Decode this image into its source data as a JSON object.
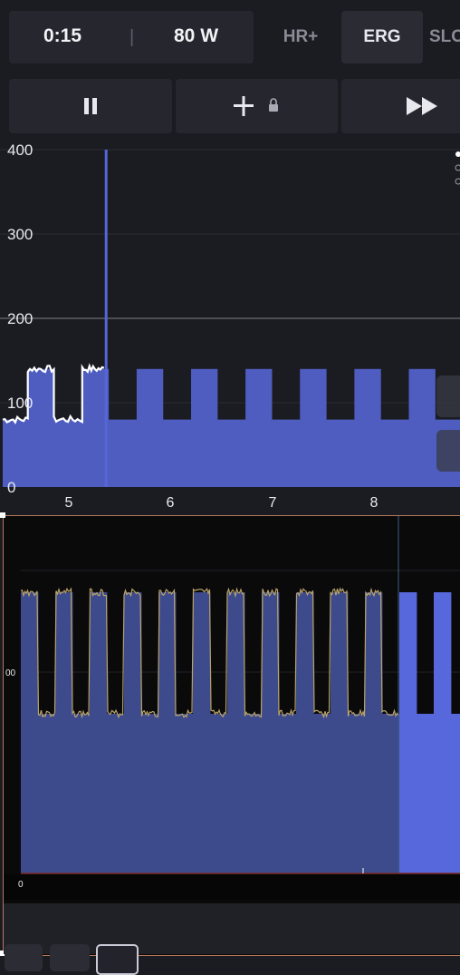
{
  "status": {
    "elapsed_time": "0:15",
    "power": "80 W"
  },
  "modes": [
    {
      "label": "HR+",
      "active": false
    },
    {
      "label": "ERG",
      "active": true
    },
    {
      "label": "SLO",
      "active": false
    }
  ],
  "controls": {
    "pause_icon": "pause-icon",
    "add_icon": "plus-icon",
    "lock_icon": "lock-icon",
    "skip_icon": "fast-forward-icon"
  },
  "colors": {
    "background": "#1b1c22",
    "plan_fill": "#4e5dbf",
    "power_line": "#ffffff",
    "cursor": "#5566d8",
    "overview_fill": "#3d4a8c",
    "overview_future": "#5767dc",
    "overview_line": "#b8a36a"
  },
  "chart_data": [
    {
      "type": "area",
      "x_tick_labels": [
        "5",
        "6",
        "7",
        "8"
      ],
      "y_tick_labels": [
        "0",
        "100",
        "200",
        "300",
        "400"
      ],
      "ylim": [
        0,
        400
      ],
      "xlim": [
        4.65,
        8.85
      ],
      "cursor_x": 5.6,
      "target_line_y": 200,
      "grid": true,
      "plan_intervals": [
        {
          "start": 4.65,
          "end": 4.88,
          "watts": 80
        },
        {
          "start": 4.88,
          "end": 5.12,
          "watts": 140
        },
        {
          "start": 5.12,
          "end": 5.38,
          "watts": 80
        },
        {
          "start": 5.38,
          "end": 5.62,
          "watts": 140
        },
        {
          "start": 5.62,
          "end": 5.88,
          "watts": 80
        },
        {
          "start": 5.88,
          "end": 6.12,
          "watts": 140
        },
        {
          "start": 6.12,
          "end": 6.38,
          "watts": 80
        },
        {
          "start": 6.38,
          "end": 6.62,
          "watts": 140
        },
        {
          "start": 6.62,
          "end": 6.88,
          "watts": 80
        },
        {
          "start": 6.88,
          "end": 7.12,
          "watts": 140
        },
        {
          "start": 7.12,
          "end": 7.38,
          "watts": 80
        },
        {
          "start": 7.38,
          "end": 7.62,
          "watts": 140
        },
        {
          "start": 7.62,
          "end": 7.88,
          "watts": 80
        },
        {
          "start": 7.88,
          "end": 8.12,
          "watts": 140
        },
        {
          "start": 8.12,
          "end": 8.38,
          "watts": 80
        },
        {
          "start": 8.38,
          "end": 8.62,
          "watts": 140
        },
        {
          "start": 8.62,
          "end": 8.85,
          "watts": 80
        }
      ]
    },
    {
      "type": "area",
      "y_tick_labels": [
        "00",
        "0"
      ],
      "note_y_tick_visible": "00",
      "intervals": 12,
      "high_watts": 140,
      "low_watts": 80,
      "progress_fraction": 0.86
    }
  ]
}
